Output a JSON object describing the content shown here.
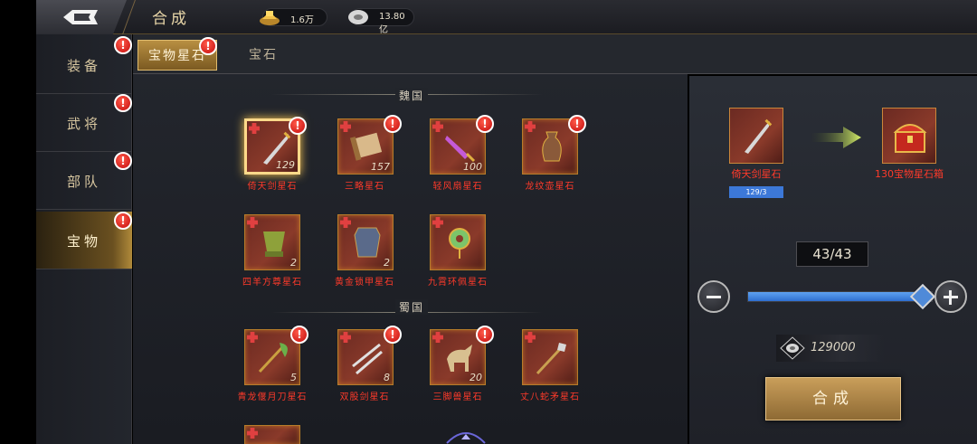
{
  "topbar": {
    "title": "合成",
    "gold": "1.6万",
    "silver": "13.80亿"
  },
  "leftnav": {
    "items": [
      {
        "label": "装备",
        "badge": "!"
      },
      {
        "label": "武将",
        "badge": "!"
      },
      {
        "label": "部队",
        "badge": "!"
      },
      {
        "label": "宝物",
        "badge": "!",
        "active": true
      }
    ]
  },
  "tabs": [
    {
      "label": "宝物星石",
      "badge": "!",
      "active": true
    },
    {
      "label": "宝石"
    }
  ],
  "sections": [
    {
      "title": "魏国",
      "items": [
        {
          "name": "倚天剑星石",
          "count": "129",
          "badge": "!",
          "icon": "sword-icon",
          "selected": true
        },
        {
          "name": "三略星石",
          "count": "157",
          "badge": "!",
          "icon": "scroll-icon"
        },
        {
          "name": "轻风扇星石",
          "count": "100",
          "badge": "!",
          "icon": "fan-icon"
        },
        {
          "name": "龙纹壶星石",
          "count": "",
          "badge": "!",
          "icon": "vase-icon"
        },
        {
          "name": "四羊方尊星石",
          "count": "2",
          "icon": "cauldron-icon"
        },
        {
          "name": "黄金锁甲星石",
          "count": "2",
          "icon": "armor-icon"
        },
        {
          "name": "九霄环佩星石",
          "count": "",
          "icon": "jade-pendant-icon"
        }
      ]
    },
    {
      "title": "蜀国",
      "items": [
        {
          "name": "青龙偃月刀星石",
          "count": "5",
          "badge": "!",
          "icon": "glaive-icon"
        },
        {
          "name": "双股剑星石",
          "count": "8",
          "badge": "!",
          "icon": "twin-swords-icon"
        },
        {
          "name": "三脚兽星石",
          "count": "20",
          "badge": "!",
          "icon": "horse-icon"
        },
        {
          "name": "丈八蛇矛星石",
          "count": "",
          "icon": "spear-icon"
        }
      ]
    }
  ],
  "synthesis": {
    "source_name": "倚天剑星石",
    "source_progress": "129/3",
    "target_name": "130宝物星石箱",
    "quantity": "43/43",
    "slider_fraction": 1.0,
    "cost": "129000",
    "button_label": "合成"
  },
  "colors": {
    "accent_gold": "#c99e5a",
    "item_name_red": "#ff3a2a",
    "badge_red": "#c40d0d",
    "slider_blue": "#3c78d8"
  }
}
